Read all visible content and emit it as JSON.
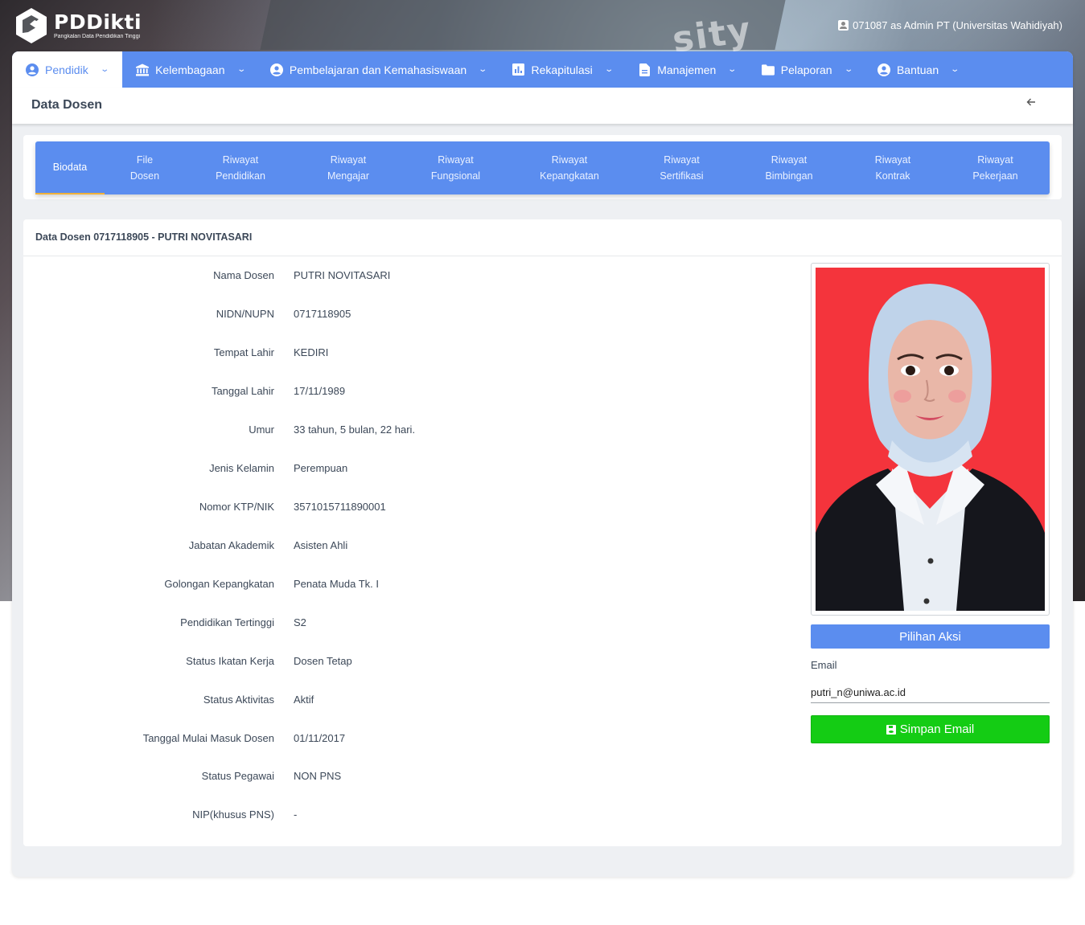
{
  "header": {
    "logo_title": "PDDikti",
    "logo_subtitle": "Pangkalan Data Pendidikan Tinggi",
    "user_info": "071087 as Admin PT (Universitas Wahidiyah)"
  },
  "nav": {
    "items": [
      {
        "label": "Pendidik",
        "icon": "user-circle-icon"
      },
      {
        "label": "Kelembagaan",
        "icon": "institution-icon"
      },
      {
        "label": "Pembelajaran dan Kemahasiswaan",
        "icon": "user-circle-icon"
      },
      {
        "label": "Rekapitulasi",
        "icon": "bar-chart-icon"
      },
      {
        "label": "Manajemen",
        "icon": "document-icon"
      },
      {
        "label": "Pelaporan",
        "icon": "folder-icon"
      },
      {
        "label": "Bantuan",
        "icon": "user-circle-icon"
      }
    ]
  },
  "page": {
    "title": "Data Dosen",
    "back_icon": "arrow-left-icon"
  },
  "tabs": [
    {
      "line1": "Biodata",
      "line2": ""
    },
    {
      "line1": "File",
      "line2": "Dosen"
    },
    {
      "line1": "Riwayat",
      "line2": "Pendidikan"
    },
    {
      "line1": "Riwayat",
      "line2": "Mengajar"
    },
    {
      "line1": "Riwayat",
      "line2": "Fungsional"
    },
    {
      "line1": "Riwayat",
      "line2": "Kepangkatan"
    },
    {
      "line1": "Riwayat",
      "line2": "Sertifikasi"
    },
    {
      "line1": "Riwayat",
      "line2": "Bimbingan"
    },
    {
      "line1": "Riwayat",
      "line2": "Kontrak"
    },
    {
      "line1": "Riwayat",
      "line2": "Pekerjaan"
    }
  ],
  "content": {
    "title": "Data Dosen 0717118905 - PUTRI NOVITASARI",
    "fields": [
      {
        "label": "Nama Dosen",
        "value": "PUTRI NOVITASARI"
      },
      {
        "label": "NIDN/NUPN",
        "value": "0717118905"
      },
      {
        "label": "Tempat Lahir",
        "value": "KEDIRI"
      },
      {
        "label": "Tanggal Lahir",
        "value": "17/11/1989"
      },
      {
        "label": "Umur",
        "value": "33 tahun, 5 bulan, 22 hari."
      },
      {
        "label": "Jenis Kelamin",
        "value": "Perempuan"
      },
      {
        "label": "Nomor KTP/NIK",
        "value": "3571015711890001"
      },
      {
        "label": "Jabatan Akademik",
        "value": "Asisten Ahli"
      },
      {
        "label": "Golongan Kepangkatan",
        "value": "Penata Muda Tk. I"
      },
      {
        "label": "Pendidikan Tertinggi",
        "value": "S2"
      },
      {
        "label": "Status Ikatan Kerja",
        "value": "Dosen Tetap"
      },
      {
        "label": "Status Aktivitas",
        "value": "Aktif"
      },
      {
        "label": "Tanggal Mulai Masuk Dosen",
        "value": "01/11/2017"
      },
      {
        "label": "Status Pegawai",
        "value": "NON PNS"
      },
      {
        "label": "NIP(khusus PNS)",
        "value": "-"
      }
    ],
    "action_button": "Pilihan Aksi",
    "email_label": "Email",
    "email_value": "putri_n@uniwa.ac.id",
    "save_button": "Simpan Email"
  },
  "colors": {
    "primary": "#5b8def",
    "save": "#14cc14",
    "photo_bg": "#f4343c",
    "active_tab_underline": "#f0b13a"
  }
}
